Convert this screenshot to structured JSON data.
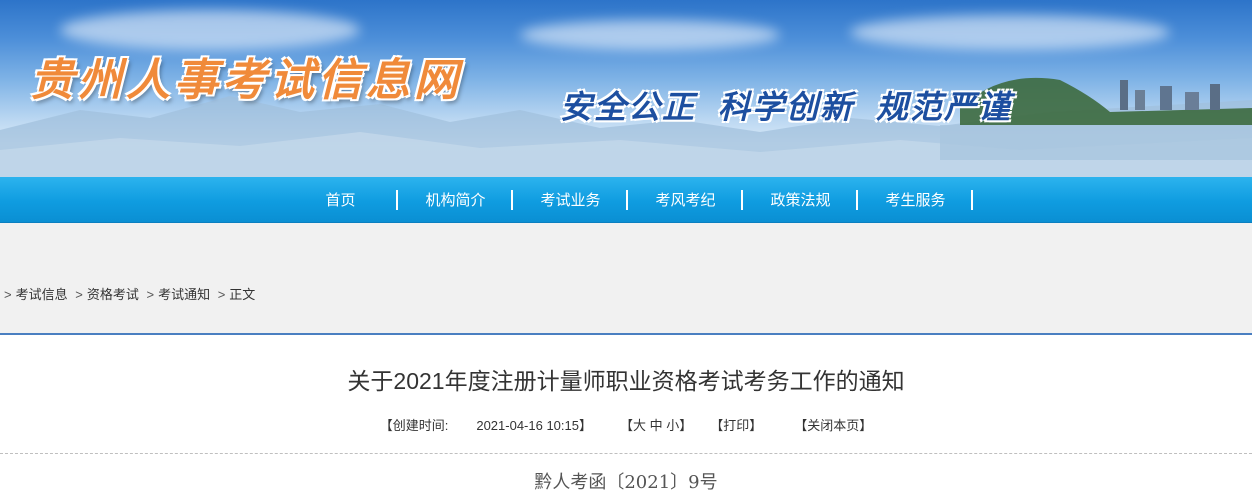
{
  "header": {
    "site_title": "贵州人事考试信息网",
    "slogan": [
      "安全公正",
      "科学创新",
      "规范严谨"
    ]
  },
  "nav": {
    "items": [
      {
        "label": "首页"
      },
      {
        "label": "机构简介"
      },
      {
        "label": "考试业务"
      },
      {
        "label": "考风考纪"
      },
      {
        "label": "政策法规"
      },
      {
        "label": "考生服务"
      }
    ]
  },
  "breadcrumb": {
    "items": [
      "考试信息",
      "资格考试",
      "考试通知",
      "正文"
    ],
    "separator": ">"
  },
  "article": {
    "title": "关于2021年度注册计量师职业资格考试考务工作的通知",
    "created_label": "【创建时间:",
    "created_value": "2021-04-16 10:15】",
    "font_size_control": "【大 中 小】",
    "print_label": "【打印】",
    "close_label": "【关闭本页】",
    "doc_number": "黔人考函〔2021〕9号"
  },
  "colors": {
    "nav_bg": "#0f9ce0",
    "title_orange": "#f08a3a",
    "slogan_blue": "#1d4fa0",
    "crumb_bg": "#f1f1f1",
    "accent_line": "#4a7fc1"
  }
}
